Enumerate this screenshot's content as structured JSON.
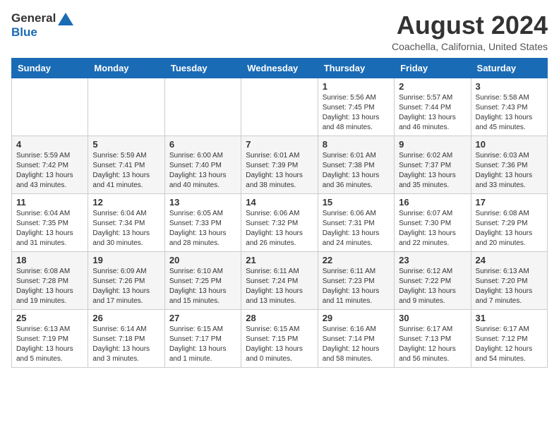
{
  "header": {
    "logo_general": "General",
    "logo_blue": "Blue",
    "month_year": "August 2024",
    "location": "Coachella, California, United States"
  },
  "weekdays": [
    "Sunday",
    "Monday",
    "Tuesday",
    "Wednesday",
    "Thursday",
    "Friday",
    "Saturday"
  ],
  "weeks": [
    [
      {
        "day": "",
        "detail": ""
      },
      {
        "day": "",
        "detail": ""
      },
      {
        "day": "",
        "detail": ""
      },
      {
        "day": "",
        "detail": ""
      },
      {
        "day": "1",
        "detail": "Sunrise: 5:56 AM\nSunset: 7:45 PM\nDaylight: 13 hours\nand 48 minutes."
      },
      {
        "day": "2",
        "detail": "Sunrise: 5:57 AM\nSunset: 7:44 PM\nDaylight: 13 hours\nand 46 minutes."
      },
      {
        "day": "3",
        "detail": "Sunrise: 5:58 AM\nSunset: 7:43 PM\nDaylight: 13 hours\nand 45 minutes."
      }
    ],
    [
      {
        "day": "4",
        "detail": "Sunrise: 5:59 AM\nSunset: 7:42 PM\nDaylight: 13 hours\nand 43 minutes."
      },
      {
        "day": "5",
        "detail": "Sunrise: 5:59 AM\nSunset: 7:41 PM\nDaylight: 13 hours\nand 41 minutes."
      },
      {
        "day": "6",
        "detail": "Sunrise: 6:00 AM\nSunset: 7:40 PM\nDaylight: 13 hours\nand 40 minutes."
      },
      {
        "day": "7",
        "detail": "Sunrise: 6:01 AM\nSunset: 7:39 PM\nDaylight: 13 hours\nand 38 minutes."
      },
      {
        "day": "8",
        "detail": "Sunrise: 6:01 AM\nSunset: 7:38 PM\nDaylight: 13 hours\nand 36 minutes."
      },
      {
        "day": "9",
        "detail": "Sunrise: 6:02 AM\nSunset: 7:37 PM\nDaylight: 13 hours\nand 35 minutes."
      },
      {
        "day": "10",
        "detail": "Sunrise: 6:03 AM\nSunset: 7:36 PM\nDaylight: 13 hours\nand 33 minutes."
      }
    ],
    [
      {
        "day": "11",
        "detail": "Sunrise: 6:04 AM\nSunset: 7:35 PM\nDaylight: 13 hours\nand 31 minutes."
      },
      {
        "day": "12",
        "detail": "Sunrise: 6:04 AM\nSunset: 7:34 PM\nDaylight: 13 hours\nand 30 minutes."
      },
      {
        "day": "13",
        "detail": "Sunrise: 6:05 AM\nSunset: 7:33 PM\nDaylight: 13 hours\nand 28 minutes."
      },
      {
        "day": "14",
        "detail": "Sunrise: 6:06 AM\nSunset: 7:32 PM\nDaylight: 13 hours\nand 26 minutes."
      },
      {
        "day": "15",
        "detail": "Sunrise: 6:06 AM\nSunset: 7:31 PM\nDaylight: 13 hours\nand 24 minutes."
      },
      {
        "day": "16",
        "detail": "Sunrise: 6:07 AM\nSunset: 7:30 PM\nDaylight: 13 hours\nand 22 minutes."
      },
      {
        "day": "17",
        "detail": "Sunrise: 6:08 AM\nSunset: 7:29 PM\nDaylight: 13 hours\nand 20 minutes."
      }
    ],
    [
      {
        "day": "18",
        "detail": "Sunrise: 6:08 AM\nSunset: 7:28 PM\nDaylight: 13 hours\nand 19 minutes."
      },
      {
        "day": "19",
        "detail": "Sunrise: 6:09 AM\nSunset: 7:26 PM\nDaylight: 13 hours\nand 17 minutes."
      },
      {
        "day": "20",
        "detail": "Sunrise: 6:10 AM\nSunset: 7:25 PM\nDaylight: 13 hours\nand 15 minutes."
      },
      {
        "day": "21",
        "detail": "Sunrise: 6:11 AM\nSunset: 7:24 PM\nDaylight: 13 hours\nand 13 minutes."
      },
      {
        "day": "22",
        "detail": "Sunrise: 6:11 AM\nSunset: 7:23 PM\nDaylight: 13 hours\nand 11 minutes."
      },
      {
        "day": "23",
        "detail": "Sunrise: 6:12 AM\nSunset: 7:22 PM\nDaylight: 13 hours\nand 9 minutes."
      },
      {
        "day": "24",
        "detail": "Sunrise: 6:13 AM\nSunset: 7:20 PM\nDaylight: 13 hours\nand 7 minutes."
      }
    ],
    [
      {
        "day": "25",
        "detail": "Sunrise: 6:13 AM\nSunset: 7:19 PM\nDaylight: 13 hours\nand 5 minutes."
      },
      {
        "day": "26",
        "detail": "Sunrise: 6:14 AM\nSunset: 7:18 PM\nDaylight: 13 hours\nand 3 minutes."
      },
      {
        "day": "27",
        "detail": "Sunrise: 6:15 AM\nSunset: 7:17 PM\nDaylight: 13 hours\nand 1 minute."
      },
      {
        "day": "28",
        "detail": "Sunrise: 6:15 AM\nSunset: 7:15 PM\nDaylight: 13 hours\nand 0 minutes."
      },
      {
        "day": "29",
        "detail": "Sunrise: 6:16 AM\nSunset: 7:14 PM\nDaylight: 12 hours\nand 58 minutes."
      },
      {
        "day": "30",
        "detail": "Sunrise: 6:17 AM\nSunset: 7:13 PM\nDaylight: 12 hours\nand 56 minutes."
      },
      {
        "day": "31",
        "detail": "Sunrise: 6:17 AM\nSunset: 7:12 PM\nDaylight: 12 hours\nand 54 minutes."
      }
    ]
  ]
}
